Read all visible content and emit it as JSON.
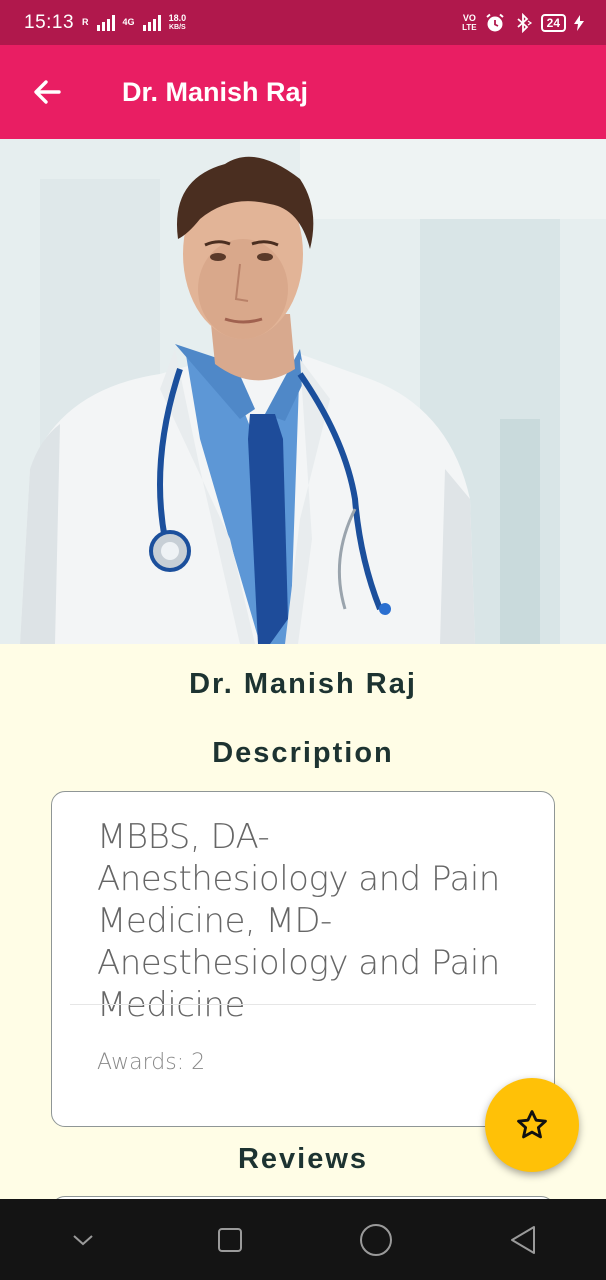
{
  "status_bar": {
    "time": "15:13",
    "carrier_r": "R",
    "network_4g": "4G",
    "speed_value": "18.0",
    "speed_unit": "KB/S",
    "volte_top": "VO",
    "volte_bottom": "LTE",
    "battery": "24"
  },
  "app_bar": {
    "title": "Dr. Manish Raj",
    "back_icon": "arrow-back-icon"
  },
  "doctor": {
    "name": "Dr. Manish Raj",
    "description_heading": "Description",
    "description": "MBBS, DA-Anesthesiology and Pain Medicine, MD-Anesthesiology and Pain Medicine",
    "awards": "Awards: 2",
    "reviews_heading": "Reviews"
  },
  "fab": {
    "icon": "star-outline-icon"
  },
  "nav_bar": {
    "icons": [
      "chevron-down-icon",
      "recent-apps-icon",
      "home-icon",
      "back-icon"
    ]
  },
  "colors": {
    "status_bar": "#b0184c",
    "app_bar": "#e91e63",
    "background": "#fffde6",
    "fab": "#ffc107",
    "heading_text": "#1d3331"
  }
}
